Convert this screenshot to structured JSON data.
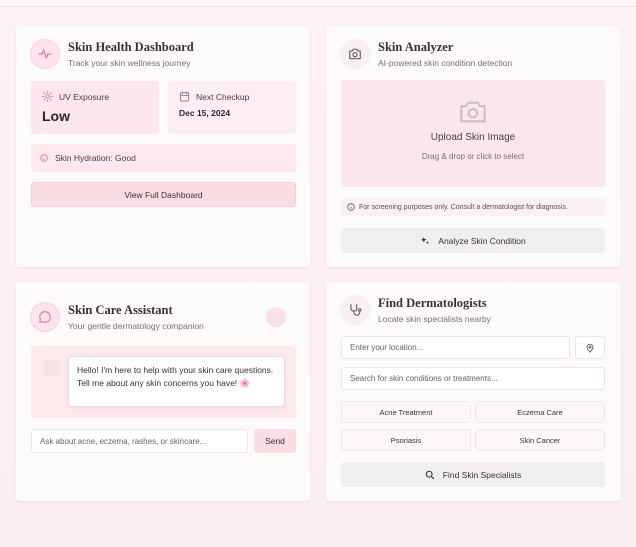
{
  "dashboard": {
    "title": "Skin Health Dashboard",
    "subtitle": "Track your skin wellness journey",
    "uv_label": "UV Exposure",
    "uv_value": "Low",
    "checkup_label": "Next Checkup",
    "checkup_value": "Dec 15, 2024",
    "hydration": "Skin Hydration: Good",
    "button": "View Full Dashboard"
  },
  "analyzer": {
    "title": "Skin Analyzer",
    "subtitle": "AI-powered skin condition detection",
    "upload_title": "Upload Skin Image",
    "upload_sub": "Drag & drop or click to select",
    "disclaimer": "For screening purposes only. Consult a dermatologist for diagnosis.",
    "button": "Analyze Skin Condition"
  },
  "assistant": {
    "title": "Skin Care Assistant",
    "subtitle": "Your gentle dermatology companion",
    "message": "Hello! I'm here to help with your skin care questions. Tell me about any skin concerns you have! 🌸",
    "input_placeholder": "Ask about acne, eczema, rashes, or skincare...",
    "send": "Send"
  },
  "dermatologists": {
    "title": "Find Dermatologists",
    "subtitle": "Locate skin specialists nearby",
    "location_placeholder": "Enter your location...",
    "condition_placeholder": "Search for skin conditions or treatments...",
    "tags": [
      "Acne Treatment",
      "Eczema Care",
      "Psoriasis",
      "Skin Cancer"
    ],
    "button": "Find Skin Specialists"
  },
  "colors": {
    "accent": "#fbdde4",
    "card": "#fdfbfa",
    "icon": "#e27a93"
  },
  "icons": {
    "dashboard": "activity-icon",
    "uv": "sun-icon",
    "checkup": "calendar-icon",
    "hydration": "droplet-icon",
    "analyzer": "camera-icon",
    "disclaimer": "info-icon",
    "analyze": "sparkles-icon",
    "assistant": "chat-bubble-icon",
    "dermatologists": "stethoscope-icon",
    "location": "map-pin-icon",
    "search": "search-icon"
  }
}
